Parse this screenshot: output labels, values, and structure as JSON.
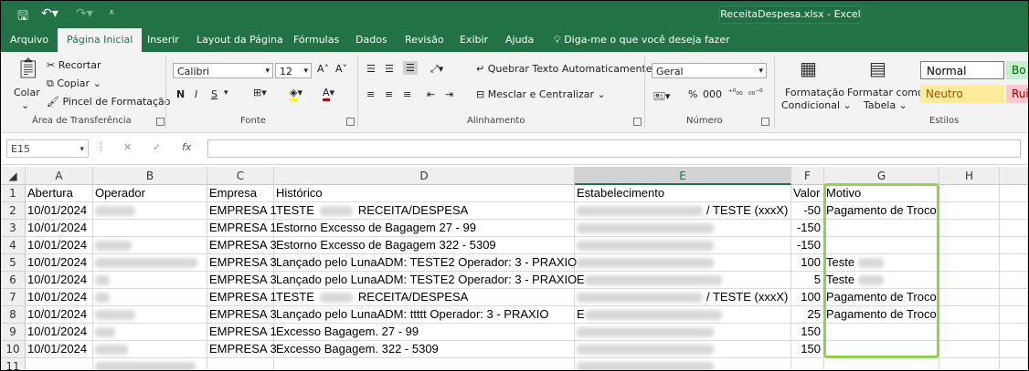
{
  "window": {
    "file_title": "ReceitaDespesa.xlsx  -  Excel"
  },
  "tabs": [
    "Arquivo",
    "Página Inicial",
    "Inserir",
    "Layout da Página",
    "Fórmulas",
    "Dados",
    "Revisão",
    "Exibir",
    "Ajuda"
  ],
  "tell_me": "Diga-me o que você deseja fazer",
  "ribbon": {
    "clipboard": {
      "paste": "Colar",
      "cut": "Recortar",
      "copy": "Copiar",
      "format_painter": "Pincel de Formatação",
      "label": "Área de Transferência"
    },
    "font": {
      "name": "Calibri",
      "size": "12",
      "bold": "N",
      "italic": "I",
      "underline": "S",
      "label": "Fonte"
    },
    "alignment": {
      "wrap": "Quebrar Texto Automaticamente",
      "merge": "Mesclar e Centralizar",
      "label": "Alinhamento"
    },
    "number": {
      "format": "Geral",
      "percent": "%",
      "thousands": "000",
      "label": "Número"
    },
    "styles": {
      "conditional_1": "Formatação",
      "conditional_2": "Condicional",
      "table_1": "Formatar como",
      "table_2": "Tabela",
      "normal": "Normal",
      "neutral": "Neutro",
      "good": "Bo",
      "bad": "Rui",
      "label": "Estilos"
    }
  },
  "formula_bar": {
    "name_box": "E15",
    "fx": "fx",
    "value": ""
  },
  "columns": [
    "A",
    "B",
    "C",
    "D",
    "E",
    "F",
    "G",
    "H"
  ],
  "rows": [
    {
      "n": "1",
      "A": "Abertura",
      "B": "Operador",
      "C": "Empresa",
      "D": "Histórico",
      "E": "Estabelecimento",
      "F": "Valor",
      "G": "Motivo"
    },
    {
      "n": "2",
      "A": "10/01/2024",
      "C": "EMPRESA 1",
      "D": "TESTE",
      "D2": "RECEITA/DESPESA",
      "E": "/ TESTE (xxxX)",
      "F": "-50",
      "G": "Pagamento de Troco"
    },
    {
      "n": "3",
      "A": "10/01/2024",
      "C": "EMPRESA 1",
      "D": "Estorno Excesso de Bagagem 27 - 99",
      "E": "",
      "F": "-150",
      "G": ""
    },
    {
      "n": "4",
      "A": "10/01/2024",
      "C": "EMPRESA 3",
      "D": "Estorno Excesso de Bagagem 322 - 5309",
      "E": "",
      "F": "-150",
      "G": ""
    },
    {
      "n": "5",
      "A": "10/01/2024",
      "C": "EMPRESA 3",
      "D": "Lançado pelo LunaADM: TESTE2 Operador: 3 - PRAXIO",
      "E": "",
      "F": "100",
      "G": "Teste"
    },
    {
      "n": "6",
      "A": "10/01/2024",
      "C": "EMPRESA 3",
      "D": "Lançado pelo LunaADM: TESTE2 Operador: 3 - PRAXIO",
      "E": "E",
      "F": "5",
      "G": "Teste"
    },
    {
      "n": "7",
      "A": "10/01/2024",
      "C": "EMPRESA 1",
      "D": "TESTE",
      "D2": "RECEITA/DESPESA",
      "E": "/ TESTE (xxxX)",
      "F": "100",
      "G": "Pagamento de Troco"
    },
    {
      "n": "8",
      "A": "10/01/2024",
      "C": "EMPRESA 3",
      "D": "Lançado pelo LunaADM: ttttt Operador: 3 - PRAXIO",
      "E": "E",
      "F": "25",
      "G": "Pagamento de Troco"
    },
    {
      "n": "9",
      "A": "10/01/2024",
      "C": "EMPRESA 1",
      "D": "Excesso Bagagem. 27 - 99",
      "E": "",
      "F": "150",
      "G": ""
    },
    {
      "n": "10",
      "A": "10/01/2024",
      "C": "EMPRESA 3",
      "D": "Excesso Bagagem. 322 - 5309",
      "E": "",
      "F": "150",
      "G": ""
    },
    {
      "n": "11",
      "A": "",
      "C": "",
      "D": "",
      "E": "",
      "F": "",
      "G": ""
    }
  ]
}
